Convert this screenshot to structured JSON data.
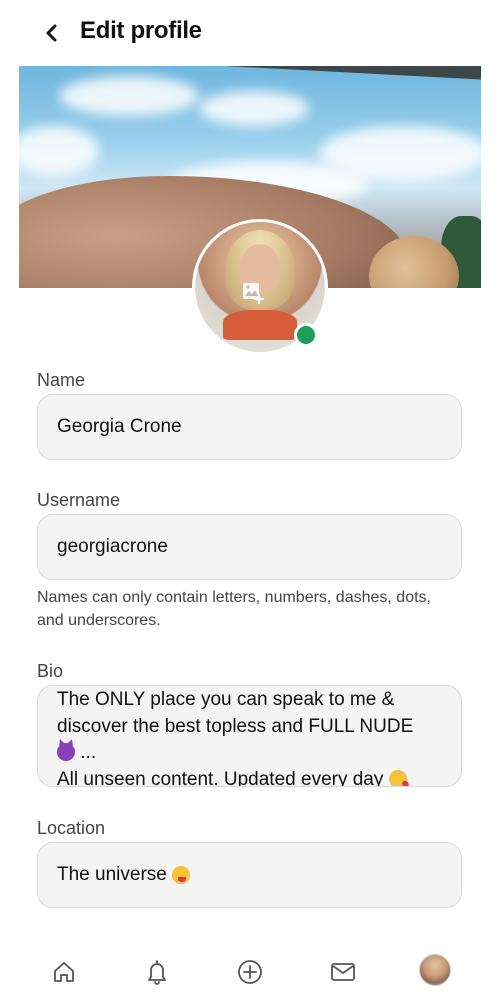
{
  "header": {
    "back_icon": "chevron-left-icon",
    "title": "Edit profile"
  },
  "cover": {
    "change_icon": "image-add-icon"
  },
  "avatar": {
    "change_icon": "image-add-icon",
    "status": "online",
    "status_color": "#1f9e5a"
  },
  "fields": {
    "name": {
      "label": "Name",
      "value": "Georgia Crone"
    },
    "username": {
      "label": "Username",
      "value": "georgiacrone",
      "hint": "Names can only contain letters, numbers, dashes, dots, and underscores."
    },
    "bio": {
      "label": "Bio",
      "line1": "The ONLY place you can speak to me &",
      "line2": "discover the best topless and FULL NUDE",
      "line3_text": "...",
      "line3_emoji": "smiling-devil-emoji",
      "line4_text": "All unseen content. Updated every day",
      "line4_emoji": "face-blowing-kiss-emoji"
    },
    "location": {
      "label": "Location",
      "value": "The universe",
      "emoji": "winking-face-with-tongue-emoji"
    }
  },
  "bottom_nav": {
    "items": [
      {
        "icon": "home-icon"
      },
      {
        "icon": "bell-icon"
      },
      {
        "icon": "plus-circle-icon"
      },
      {
        "icon": "mail-icon"
      },
      {
        "icon": "profile-avatar"
      }
    ]
  },
  "colors": {
    "field_background": "#f4f4f4",
    "field_border": "#d9d9d9",
    "label_text": "#444444",
    "online_green": "#1f9e5a"
  }
}
